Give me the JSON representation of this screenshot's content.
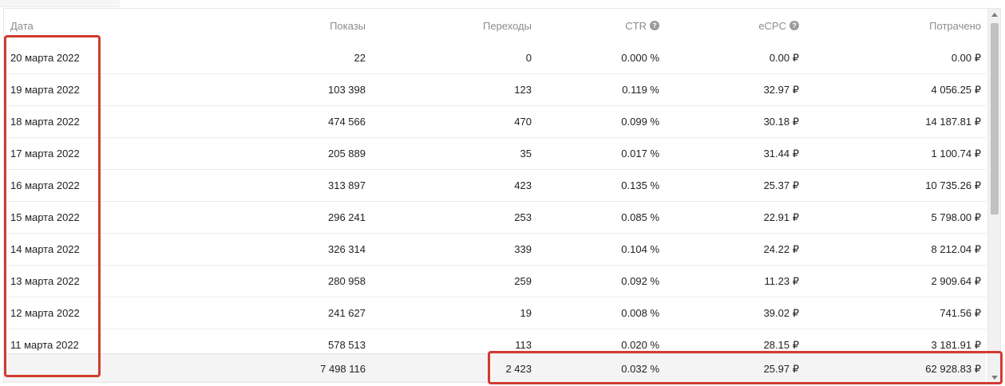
{
  "table": {
    "columns": {
      "date": "Дата",
      "shows": "Показы",
      "clicks": "Переходы",
      "ctr": "CTR",
      "ecpc": "eCPC",
      "spent": "Потрачено"
    },
    "help_glyph": "?",
    "rows": [
      {
        "date": "20 марта 2022",
        "shows": "22",
        "clicks": "0",
        "ctr": "0.000 %",
        "ecpc": "0.00 ₽",
        "spent": "0.00 ₽"
      },
      {
        "date": "19 марта 2022",
        "shows": "103 398",
        "clicks": "123",
        "ctr": "0.119 %",
        "ecpc": "32.97 ₽",
        "spent": "4 056.25 ₽"
      },
      {
        "date": "18 марта 2022",
        "shows": "474 566",
        "clicks": "470",
        "ctr": "0.099 %",
        "ecpc": "30.18 ₽",
        "spent": "14 187.81 ₽"
      },
      {
        "date": "17 марта 2022",
        "shows": "205 889",
        "clicks": "35",
        "ctr": "0.017 %",
        "ecpc": "31.44 ₽",
        "spent": "1 100.74 ₽"
      },
      {
        "date": "16 марта 2022",
        "shows": "313 897",
        "clicks": "423",
        "ctr": "0.135 %",
        "ecpc": "25.37 ₽",
        "spent": "10 735.26 ₽"
      },
      {
        "date": "15 марта 2022",
        "shows": "296 241",
        "clicks": "253",
        "ctr": "0.085 %",
        "ecpc": "22.91 ₽",
        "spent": "5 798.00 ₽"
      },
      {
        "date": "14 марта 2022",
        "shows": "326 314",
        "clicks": "339",
        "ctr": "0.104 %",
        "ecpc": "24.22 ₽",
        "spent": "8 212.04 ₽"
      },
      {
        "date": "13 марта 2022",
        "shows": "280 958",
        "clicks": "259",
        "ctr": "0.092 %",
        "ecpc": "11.23 ₽",
        "spent": "2 909.64 ₽"
      },
      {
        "date": "12 марта 2022",
        "shows": "241 627",
        "clicks": "19",
        "ctr": "0.008 %",
        "ecpc": "39.02 ₽",
        "spent": "741.56 ₽"
      },
      {
        "date": "11 марта 2022",
        "shows": "578 513",
        "clicks": "113",
        "ctr": "0.020 %",
        "ecpc": "28.15 ₽",
        "spent": "3 181.91 ₽"
      }
    ],
    "totals": {
      "date": "",
      "shows": "7 498 116",
      "clicks": "2 423",
      "ctr": "0.032 %",
      "ecpc": "25.97 ₽",
      "spent": "62 928.83 ₽"
    }
  },
  "colors": {
    "highlight": "#d23a30",
    "header_text": "#8c8c8c",
    "totals_background": "#f4f4f4"
  }
}
